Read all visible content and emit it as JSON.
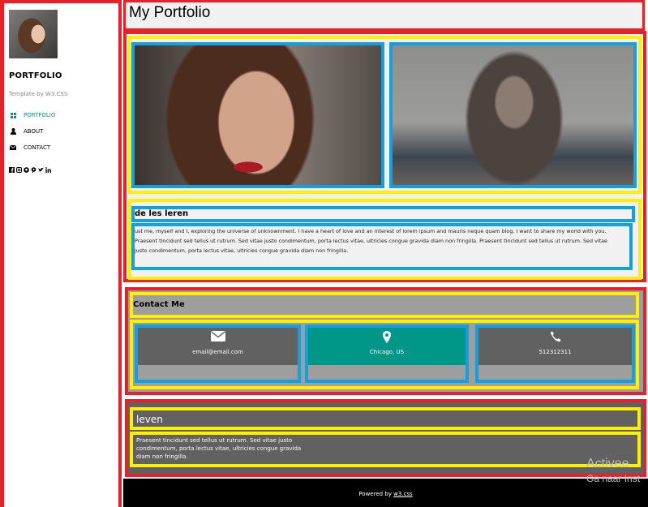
{
  "sidebar": {
    "brand": "PORTFOLIO",
    "tagline": "Template by W3.CSS",
    "nav": [
      {
        "label": "PORTFOLIO",
        "icon": "grid-icon",
        "active": true
      },
      {
        "label": "ABOUT",
        "icon": "user-icon",
        "active": false
      },
      {
        "label": "CONTACT",
        "icon": "envelope-icon",
        "active": false
      }
    ],
    "social_icons": [
      "facebook-icon",
      "instagram-icon",
      "snapchat-icon",
      "pinterest-icon",
      "twitter-icon",
      "linkedin-icon"
    ]
  },
  "header": {
    "title": "My Portfolio"
  },
  "about": {
    "heading": "de les leren",
    "text_lines": [
      "ust me, myself and I, exploring the universe of unknownment. I have a heart of love and an interest of lorem ipsum and mauris neque quam blog. I want to share my world with you.",
      "Praesent tincidunt sed tellus ut rutrum. Sed vitae justo condimentum, porta lectus vitae, ultricies congue gravida diam non fringilla. Praesent tincidunt sed tellus ut rutrum. Sed vitae",
      "justo condimentum, porta lectus vitae, ultricies congue gravida diam non fringilla."
    ]
  },
  "contact": {
    "heading": "Contact Me",
    "cards": [
      {
        "icon": "envelope-icon",
        "label": "email@email.com",
        "color": "#616161"
      },
      {
        "icon": "map-marker-icon",
        "label": "Chicago, US",
        "color": "#009688"
      },
      {
        "icon": "phone-icon",
        "label": "512312311",
        "color": "#616161"
      }
    ]
  },
  "leven": {
    "heading": "leven",
    "text": "Praesent tincidunt sed tellus ut rutrum. Sed vitae justo condimentum, porta lectus vitae, ultricies congue gravida diam non fringilla."
  },
  "footer": {
    "prefix": "Powered by ",
    "link": "w3.css"
  },
  "watermark": {
    "line1": "Activee",
    "line2": "Ga naar Inst"
  },
  "colors": {
    "accent": "#009688",
    "outline_red": "#e8202a",
    "outline_yellow": "#ffef00",
    "outline_blue": "#12a0e0"
  }
}
